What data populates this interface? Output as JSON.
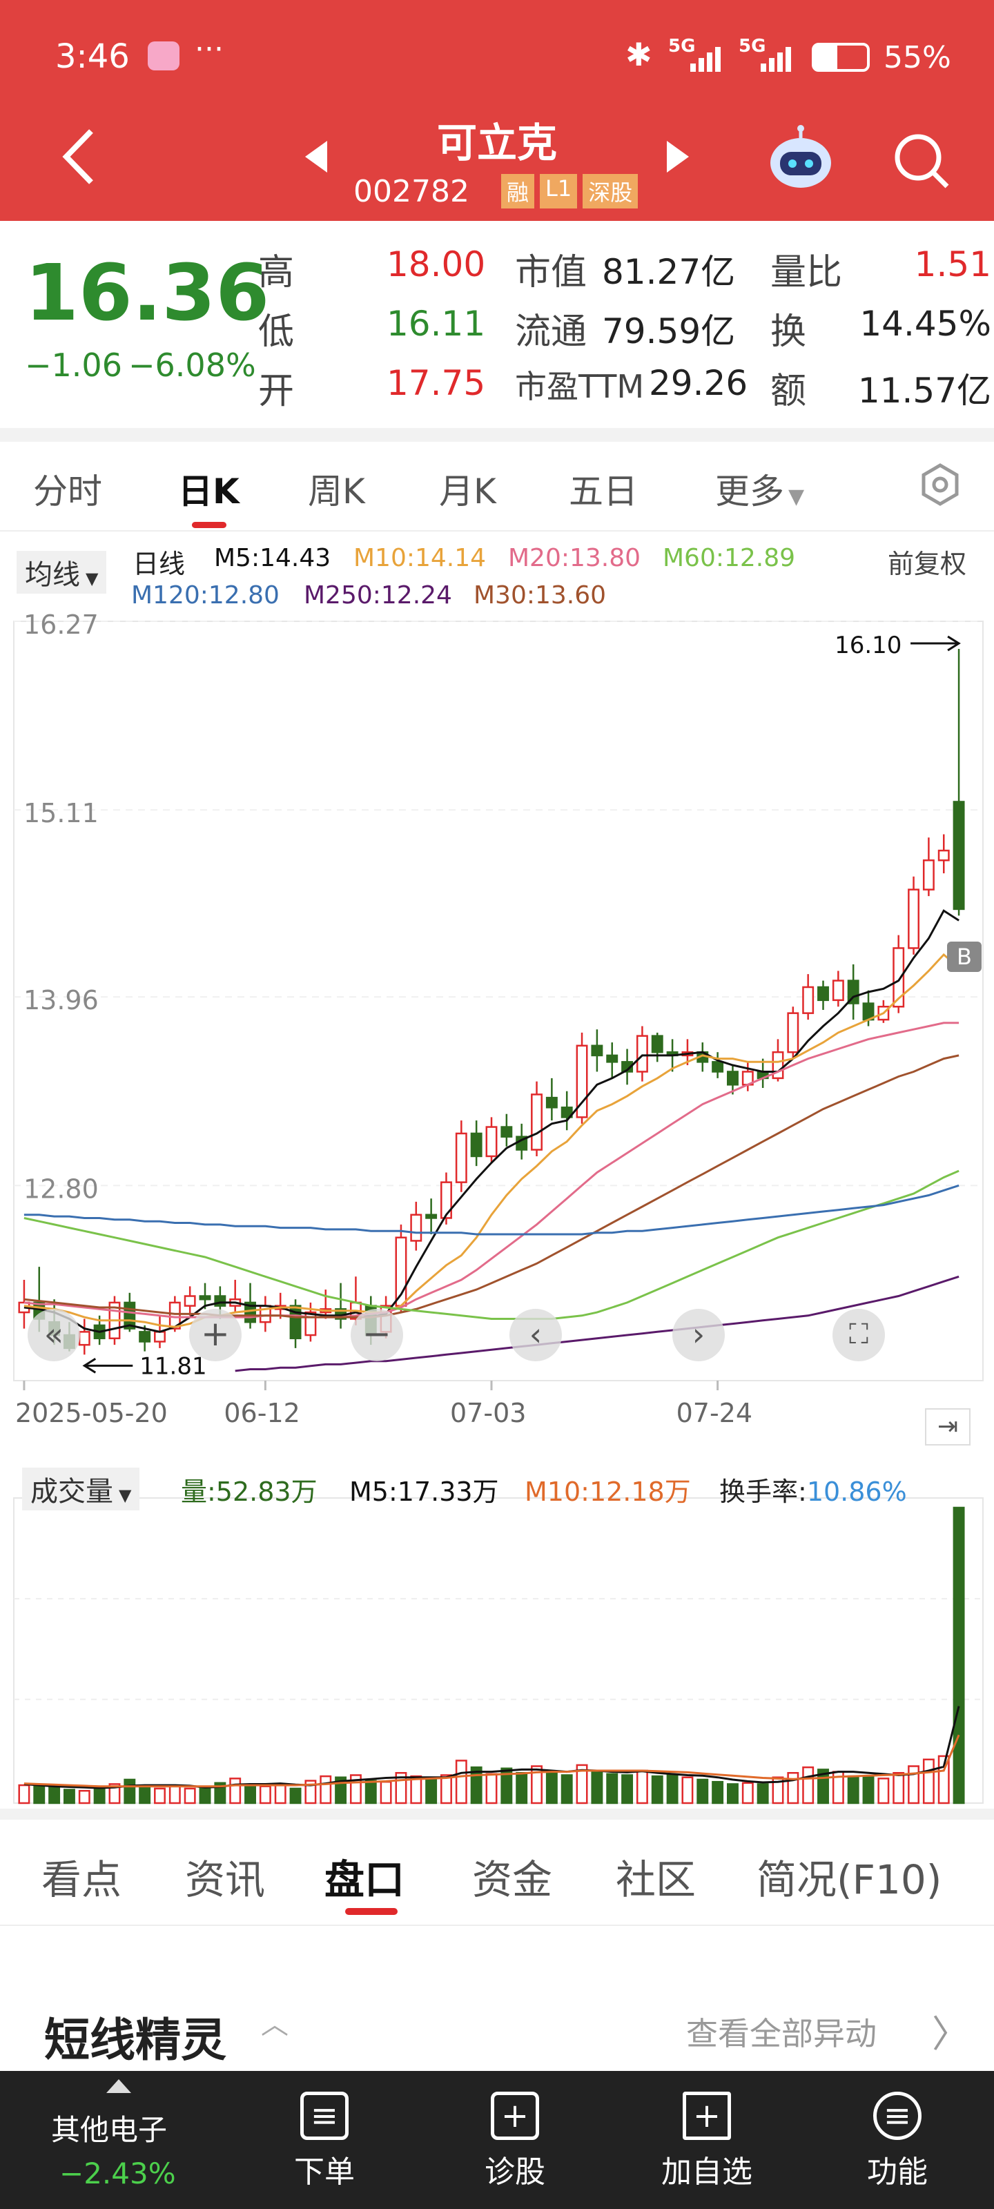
{
  "status": {
    "time": "3:46",
    "battery": "55%",
    "net1": "5G",
    "net2": "5G"
  },
  "header": {
    "name": "可立克",
    "code": "002782",
    "tags": [
      "融",
      "L1",
      "深股"
    ]
  },
  "quote": {
    "price": "16.36",
    "change": "−1.06",
    "change_pct": "−6.08%",
    "rows": [
      [
        {
          "k": "高",
          "v": "18.00",
          "c": "red"
        },
        {
          "k": "市值",
          "v": "81.27亿",
          "c": "dark"
        },
        {
          "k": "量比",
          "v": "1.51",
          "c": "red"
        }
      ],
      [
        {
          "k": "低",
          "v": "16.11",
          "c": "green"
        },
        {
          "k": "流通",
          "v": "79.59亿",
          "c": "dark"
        },
        {
          "k": "换",
          "v": "14.45%",
          "c": "dark"
        }
      ],
      [
        {
          "k": "开",
          "v": "17.75",
          "c": "red"
        },
        {
          "k": "市盈TTM",
          "v": "29.26",
          "c": "dark"
        },
        {
          "k": "额",
          "v": "11.57亿",
          "c": "dark"
        }
      ]
    ]
  },
  "ktabs": [
    "分时",
    "日K",
    "周K",
    "月K",
    "五日",
    "更多"
  ],
  "indicator": {
    "selector": "均线",
    "line_label": "日线",
    "right_label": "前复权",
    "ma": [
      {
        "label": "M5:14.43",
        "color": "#111111"
      },
      {
        "label": "M10:14.14",
        "color": "#e8a33a"
      },
      {
        "label": "M20:13.80",
        "color": "#e26b8a"
      },
      {
        "label": "M60:12.89",
        "color": "#7ac24a"
      },
      {
        "label": "M120:12.80",
        "color": "#3a6fb0"
      },
      {
        "label": "M250:12.24",
        "color": "#5a1a6a"
      },
      {
        "label": "M30:13.60",
        "color": "#a0522d"
      }
    ]
  },
  "chart_data": {
    "type": "candlestick",
    "y_ticks": [
      "16.27",
      "15.11",
      "13.96",
      "12.80"
    ],
    "x_ticks": [
      "2025-05-20",
      "06-12",
      "07-03",
      "07-24"
    ],
    "max_label": "16.10",
    "min_label": "11.81",
    "ylim": [
      11.6,
      16.27
    ],
    "candles": [
      [
        12.02,
        12.08,
        12.22,
        11.92
      ],
      [
        12.08,
        11.98,
        12.3,
        11.9
      ],
      [
        11.96,
        11.88,
        12.1,
        11.82
      ],
      [
        11.88,
        11.8,
        11.96,
        11.78
      ],
      [
        11.82,
        11.9,
        11.98,
        11.76
      ],
      [
        11.94,
        11.86,
        12.0,
        11.82
      ],
      [
        11.86,
        12.08,
        12.12,
        11.82
      ],
      [
        12.08,
        11.92,
        12.14,
        11.9
      ],
      [
        11.9,
        11.84,
        11.94,
        11.78
      ],
      [
        11.84,
        11.9,
        12.0,
        11.8
      ],
      [
        11.92,
        12.08,
        12.12,
        11.9
      ],
      [
        12.06,
        12.12,
        12.18,
        12.0
      ],
      [
        12.12,
        12.1,
        12.2,
        12.04
      ],
      [
        12.12,
        12.06,
        12.18,
        11.98
      ],
      [
        12.06,
        12.1,
        12.22,
        12.02
      ],
      [
        12.08,
        11.96,
        12.2,
        11.92
      ],
      [
        11.96,
        12.06,
        12.12,
        11.9
      ],
      [
        12.04,
        12.06,
        12.14,
        11.98
      ],
      [
        12.06,
        11.86,
        12.1,
        11.8
      ],
      [
        11.88,
        12.02,
        12.08,
        11.84
      ],
      [
        12.02,
        12.04,
        12.16,
        11.98
      ],
      [
        12.04,
        11.98,
        12.2,
        11.92
      ],
      [
        11.98,
        12.08,
        12.24,
        11.94
      ],
      [
        12.06,
        11.88,
        12.12,
        11.82
      ],
      [
        11.9,
        12.06,
        12.12,
        11.86
      ],
      [
        12.06,
        12.48,
        12.56,
        12.02
      ],
      [
        12.46,
        12.62,
        12.7,
        12.4
      ],
      [
        12.62,
        12.6,
        12.72,
        12.5
      ],
      [
        12.6,
        12.82,
        12.88,
        12.56
      ],
      [
        12.82,
        13.12,
        13.2,
        12.76
      ],
      [
        13.12,
        12.98,
        13.2,
        12.92
      ],
      [
        12.98,
        13.16,
        13.22,
        12.94
      ],
      [
        13.16,
        13.1,
        13.24,
        13.04
      ],
      [
        13.1,
        13.02,
        13.18,
        12.96
      ],
      [
        13.02,
        13.36,
        13.44,
        12.98
      ],
      [
        13.34,
        13.28,
        13.46,
        13.2
      ],
      [
        13.28,
        13.22,
        13.38,
        13.14
      ],
      [
        13.22,
        13.66,
        13.74,
        13.18
      ],
      [
        13.66,
        13.6,
        13.76,
        13.5
      ],
      [
        13.6,
        13.56,
        13.68,
        13.46
      ],
      [
        13.56,
        13.5,
        13.64,
        13.42
      ],
      [
        13.5,
        13.72,
        13.78,
        13.44
      ],
      [
        13.72,
        13.62,
        13.74,
        13.56
      ],
      [
        13.62,
        13.6,
        13.7,
        13.5
      ],
      [
        13.6,
        13.62,
        13.7,
        13.54
      ],
      [
        13.62,
        13.56,
        13.68,
        13.5
      ],
      [
        13.56,
        13.5,
        13.62,
        13.46
      ],
      [
        13.5,
        13.42,
        13.54,
        13.36
      ],
      [
        13.42,
        13.5,
        13.56,
        13.38
      ],
      [
        13.5,
        13.46,
        13.58,
        13.4
      ],
      [
        13.46,
        13.62,
        13.7,
        13.44
      ],
      [
        13.62,
        13.86,
        13.9,
        13.58
      ],
      [
        13.86,
        14.02,
        14.1,
        13.82
      ],
      [
        14.02,
        13.94,
        14.06,
        13.88
      ],
      [
        13.94,
        14.06,
        14.12,
        13.9
      ],
      [
        14.06,
        13.92,
        14.16,
        13.82
      ],
      [
        13.92,
        13.82,
        14.0,
        13.78
      ],
      [
        13.82,
        13.9,
        13.94,
        13.8
      ],
      [
        13.9,
        14.26,
        14.34,
        13.86
      ],
      [
        14.26,
        14.62,
        14.7,
        14.22
      ],
      [
        14.62,
        14.8,
        14.94,
        14.58
      ],
      [
        14.8,
        14.86,
        14.96,
        14.72
      ],
      [
        15.16,
        14.5,
        16.1,
        14.46
      ]
    ],
    "ma": {
      "M5": [
        12.05,
        12.04,
        12.02,
        11.98,
        11.92,
        11.9,
        11.92,
        11.94,
        11.92,
        11.9,
        11.93,
        11.99,
        12.06,
        12.08,
        12.08,
        12.06,
        12.06,
        12.05,
        12.02,
        12.01,
        12.0,
        12.0,
        12.02,
        11.99,
        12.01,
        12.13,
        12.3,
        12.46,
        12.62,
        12.73,
        12.84,
        12.94,
        13.03,
        13.08,
        13.12,
        13.18,
        13.2,
        13.31,
        13.42,
        13.46,
        13.51,
        13.6,
        13.6,
        13.6,
        13.61,
        13.62,
        13.57,
        13.54,
        13.52,
        13.5,
        13.5,
        13.58,
        13.69,
        13.78,
        13.86,
        13.96,
        13.99,
        14.01,
        14.06,
        14.2,
        14.32,
        14.49,
        14.43
      ],
      "M10": [
        12.06,
        12.05,
        12.04,
        12.02,
        11.99,
        11.97,
        11.97,
        11.97,
        11.96,
        11.94,
        11.93,
        11.95,
        11.99,
        12.0,
        12.02,
        12.03,
        12.04,
        12.05,
        12.05,
        12.04,
        12.03,
        12.03,
        12.03,
        12.02,
        12.02,
        12.06,
        12.15,
        12.23,
        12.31,
        12.37,
        12.48,
        12.62,
        12.74,
        12.84,
        12.92,
        13.01,
        13.07,
        13.17,
        13.26,
        13.3,
        13.35,
        13.41,
        13.46,
        13.52,
        13.56,
        13.6,
        13.58,
        13.58,
        13.56,
        13.56,
        13.56,
        13.58,
        13.63,
        13.68,
        13.74,
        13.78,
        13.82,
        13.86,
        13.95,
        14.03,
        14.12,
        14.22,
        14.14
      ],
      "M20": [
        12.08,
        12.07,
        12.07,
        12.06,
        12.05,
        12.04,
        12.03,
        12.02,
        12.01,
        12.0,
        11.99,
        11.99,
        11.99,
        11.99,
        11.99,
        11.99,
        12.0,
        12.0,
        12.0,
        11.99,
        11.99,
        11.99,
        12.0,
        12.01,
        12.02,
        12.05,
        12.1,
        12.14,
        12.18,
        12.22,
        12.28,
        12.35,
        12.42,
        12.49,
        12.56,
        12.64,
        12.72,
        12.8,
        12.88,
        12.94,
        13.0,
        13.06,
        13.12,
        13.18,
        13.24,
        13.3,
        13.34,
        13.38,
        13.42,
        13.46,
        13.5,
        13.54,
        13.58,
        13.61,
        13.64,
        13.67,
        13.7,
        13.72,
        13.74,
        13.76,
        13.78,
        13.8,
        13.8
      ],
      "M30": [
        12.1,
        12.09,
        12.08,
        12.07,
        12.06,
        12.05,
        12.05,
        12.04,
        12.03,
        12.02,
        12.01,
        12.01,
        12.01,
        12.0,
        12.0,
        12.0,
        12.0,
        12.0,
        11.99,
        11.99,
        11.99,
        11.99,
        11.99,
        11.99,
        12.0,
        12.02,
        12.04,
        12.07,
        12.1,
        12.13,
        12.16,
        12.2,
        12.24,
        12.28,
        12.32,
        12.37,
        12.42,
        12.47,
        12.52,
        12.57,
        12.62,
        12.67,
        12.72,
        12.77,
        12.82,
        12.87,
        12.92,
        12.97,
        13.02,
        13.07,
        13.12,
        13.17,
        13.22,
        13.27,
        13.31,
        13.35,
        13.39,
        13.43,
        13.47,
        13.5,
        13.54,
        13.58,
        13.6
      ],
      "M60": [
        12.6,
        12.58,
        12.56,
        12.54,
        12.52,
        12.5,
        12.48,
        12.46,
        12.44,
        12.42,
        12.4,
        12.38,
        12.36,
        12.33,
        12.3,
        12.27,
        12.24,
        12.21,
        12.18,
        12.15,
        12.12,
        12.1,
        12.08,
        12.06,
        12.05,
        12.04,
        12.03,
        12.02,
        12.01,
        12.0,
        11.99,
        11.98,
        11.98,
        11.98,
        11.98,
        11.98,
        11.99,
        12.0,
        12.02,
        12.05,
        12.08,
        12.12,
        12.16,
        12.2,
        12.24,
        12.28,
        12.32,
        12.36,
        12.4,
        12.44,
        12.48,
        12.51,
        12.54,
        12.57,
        12.6,
        12.63,
        12.66,
        12.69,
        12.72,
        12.75,
        12.8,
        12.85,
        12.89
      ],
      "M120": [
        12.62,
        12.62,
        12.61,
        12.61,
        12.6,
        12.6,
        12.59,
        12.59,
        12.58,
        12.58,
        12.57,
        12.57,
        12.56,
        12.56,
        12.55,
        12.55,
        12.55,
        12.54,
        12.54,
        12.54,
        12.53,
        12.53,
        12.53,
        12.52,
        12.52,
        12.52,
        12.51,
        12.51,
        12.51,
        12.51,
        12.5,
        12.5,
        12.5,
        12.5,
        12.5,
        12.5,
        12.5,
        12.5,
        12.51,
        12.51,
        12.52,
        12.52,
        12.53,
        12.54,
        12.55,
        12.56,
        12.57,
        12.58,
        12.59,
        12.6,
        12.61,
        12.62,
        12.63,
        12.64,
        12.65,
        12.66,
        12.67,
        12.68,
        12.7,
        12.72,
        12.74,
        12.77,
        12.8
      ],
      "M250": [
        null,
        null,
        null,
        null,
        null,
        null,
        null,
        null,
        null,
        null,
        null,
        null,
        null,
        null,
        11.66,
        11.67,
        11.67,
        11.68,
        11.68,
        11.69,
        11.7,
        11.7,
        11.71,
        11.72,
        11.72,
        11.73,
        11.74,
        11.75,
        11.76,
        11.77,
        11.78,
        11.79,
        11.8,
        11.81,
        11.82,
        11.83,
        11.84,
        11.85,
        11.86,
        11.87,
        11.88,
        11.89,
        11.9,
        11.91,
        11.92,
        11.93,
        11.94,
        11.95,
        11.96,
        11.97,
        11.98,
        11.99,
        12.0,
        12.02,
        12.04,
        12.06,
        12.08,
        12.1,
        12.12,
        12.15,
        12.18,
        12.21,
        12.24
      ]
    },
    "volume": {
      "values": [
        3.2,
        3.0,
        3.1,
        2.4,
        2.2,
        2.6,
        3.4,
        4.2,
        2.8,
        2.6,
        3.0,
        2.6,
        2.8,
        3.6,
        4.4,
        3.2,
        3.0,
        3.2,
        2.6,
        4.0,
        4.8,
        4.6,
        5.0,
        4.0,
        3.8,
        5.4,
        4.8,
        4.2,
        5.0,
        7.6,
        6.4,
        5.2,
        6.2,
        5.4,
        6.6,
        5.4,
        5.0,
        6.8,
        5.6,
        5.2,
        5.0,
        5.8,
        4.8,
        5.0,
        4.6,
        4.2,
        3.8,
        3.4,
        3.6,
        3.4,
        4.6,
        5.4,
        6.4,
        6.0,
        5.6,
        4.8,
        4.6,
        4.4,
        5.4,
        6.6,
        7.8,
        8.4,
        52.83
      ],
      "ma5_line": [
        3.4,
        3.2,
        3.0,
        2.9,
        2.8,
        2.7,
        2.8,
        3.1,
        3.2,
        3.2,
        3.2,
        3.1,
        2.8,
        2.9,
        3.3,
        3.4,
        3.4,
        3.5,
        3.3,
        3.2,
        3.5,
        3.9,
        4.1,
        4.3,
        4.5,
        4.6,
        4.6,
        4.6,
        4.6,
        5.4,
        5.6,
        5.6,
        5.8,
        6.0,
        6.0,
        5.8,
        5.6,
        5.9,
        5.8,
        5.6,
        5.5,
        5.7,
        5.4,
        5.2,
        5.0,
        4.9,
        4.6,
        4.2,
        3.9,
        3.7,
        3.8,
        4.1,
        4.7,
        5.2,
        5.6,
        5.6,
        5.4,
        5.2,
        5.0,
        5.2,
        5.8,
        6.5,
        17.33
      ],
      "ma10_line": [
        3.5,
        3.4,
        3.3,
        3.2,
        3.1,
        3.0,
        3.0,
        3.0,
        3.0,
        3.0,
        3.0,
        3.0,
        3.0,
        3.0,
        3.2,
        3.2,
        3.2,
        3.2,
        3.2,
        3.3,
        3.4,
        3.6,
        3.7,
        3.8,
        3.9,
        4.1,
        4.3,
        4.4,
        4.5,
        4.8,
        5.0,
        5.1,
        5.2,
        5.3,
        5.5,
        5.6,
        5.6,
        5.8,
        5.8,
        5.8,
        5.8,
        5.8,
        5.7,
        5.6,
        5.5,
        5.3,
        5.1,
        4.9,
        4.7,
        4.5,
        4.4,
        4.3,
        4.4,
        4.5,
        4.7,
        4.8,
        4.9,
        5.0,
        5.1,
        5.3,
        5.5,
        5.8,
        12.18
      ]
    }
  },
  "vol_header": {
    "selector": "成交量",
    "vol": "量:52.83万",
    "m5": "M5:17.33万",
    "m10": "M10:12.18万",
    "turnover_label": "换手率:",
    "turnover": "10.86%"
  },
  "bottom_tabs": [
    "看点",
    "资讯",
    "盘口",
    "资金",
    "社区",
    "简况(F10)"
  ],
  "sprite": {
    "title": "短线精灵",
    "link": "查看全部异动"
  },
  "footer": {
    "sector": "其他电子",
    "sector_change": "−2.43%",
    "items": [
      "下单",
      "诊股",
      "加自选",
      "功能"
    ]
  },
  "colors": {
    "header_bg": "#e0413f",
    "up": "#e0292b",
    "down": "#2e6b1e",
    "accent": "#e0292b",
    "turnover": "#3a8fd8"
  }
}
